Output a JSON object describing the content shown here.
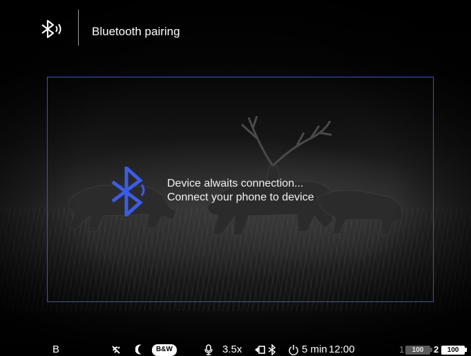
{
  "header": {
    "title": "Bluetooth pairing",
    "icon": "bluetooth-signal-icon"
  },
  "dialog": {
    "line1": "Device alwaits connection...",
    "line2": "Connect your phone to device",
    "icon": "bluetooth-icon",
    "border_color": "#3e53c8",
    "icon_color": "#3c5ce6"
  },
  "statusbar": {
    "mode": "B",
    "palette": "B&W",
    "zoom": "3.5x",
    "sleep": "5 min",
    "time": "12:00",
    "battery1_index": "1",
    "battery1_level": "100",
    "battery2_index": "2",
    "battery2_level": "100"
  }
}
